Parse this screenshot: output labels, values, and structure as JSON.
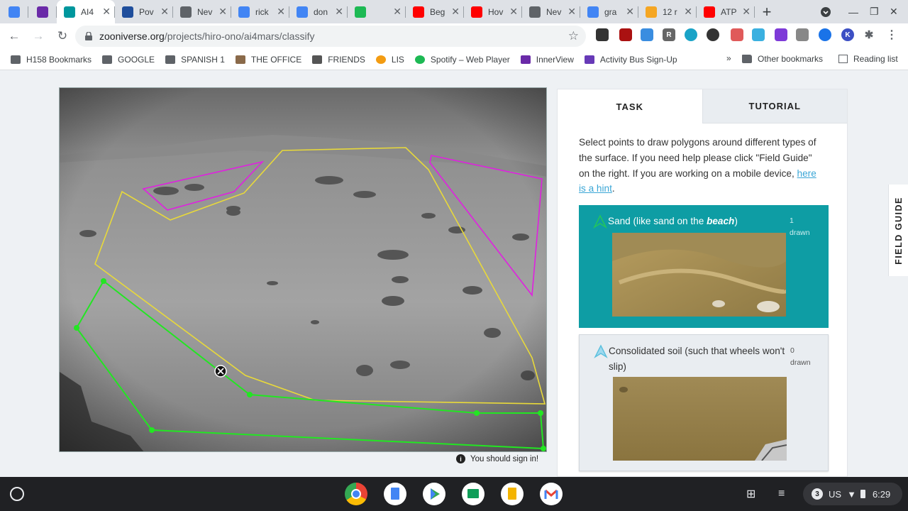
{
  "browser": {
    "tabs": [
      {
        "title": "",
        "favicon": "google-docs-icon",
        "color": "#4285f4"
      },
      {
        "title": "",
        "favicon": "innerview-icon",
        "color": "#6a2aa8"
      },
      {
        "title": "AI4",
        "favicon": "zooniverse-icon",
        "color": "#00979d",
        "active": true
      },
      {
        "title": "Pov",
        "favicon": "pearson-icon",
        "color": "#1f4e9c"
      },
      {
        "title": "Nev",
        "favicon": "chrome-icon",
        "color": "#5f6368"
      },
      {
        "title": "rick",
        "favicon": "google-icon",
        "color": "#4285f4"
      },
      {
        "title": "don",
        "favicon": "google-icon",
        "color": "#4285f4"
      },
      {
        "title": "",
        "favicon": "spotify-icon",
        "color": "#1db954"
      },
      {
        "title": "Beg",
        "favicon": "youtube-icon",
        "color": "#ff0000"
      },
      {
        "title": "Hov",
        "favicon": "youtube-icon",
        "color": "#ff0000"
      },
      {
        "title": "Nev",
        "favicon": "chrome-icon",
        "color": "#5f6368"
      },
      {
        "title": "gra",
        "favicon": "google-icon",
        "color": "#4285f4"
      },
      {
        "title": "12 r",
        "favicon": "nike-icon",
        "color": "#f5a623"
      },
      {
        "title": "ATP & R",
        "favicon": "youtube-icon",
        "color": "#ff0000"
      }
    ],
    "url_domain": "zooniverse.org",
    "url_path": "/projects/hiro-ono/ai4mars/classify"
  },
  "bookmarks": [
    {
      "label": "H158 Bookmarks",
      "icon": "bookmark-manager-icon"
    },
    {
      "label": "GOOGLE",
      "icon": "folder-icon"
    },
    {
      "label": "SPANISH 1",
      "icon": "folder-icon"
    },
    {
      "label": "THE OFFICE",
      "icon": "the-office-icon"
    },
    {
      "label": "FRIENDS",
      "icon": "friends-icon"
    },
    {
      "label": "LIS",
      "icon": "lis-icon"
    },
    {
      "label": "Spotify – Web Player",
      "icon": "spotify-icon"
    },
    {
      "label": "InnerView",
      "icon": "innerview-icon"
    },
    {
      "label": "Activity Bus Sign-Up",
      "icon": "forms-icon"
    }
  ],
  "bookmarks_overflow": "»",
  "other_bookmarks": "Other bookmarks",
  "reading_list": "Reading list",
  "signin_notice": "You should sign in!",
  "task_panel": {
    "tab_task": "TASK",
    "tab_tutorial": "TUTORIAL",
    "instructions": "Select points to draw polygons around different types of the surface. If you need help please click \"Field Guide\" on the right. If you are working on a mobile device, ",
    "hint_link": "here is a hint",
    "instructions_end": ".",
    "choices": [
      {
        "label_pre": "Sand (like sand on the ",
        "label_em": "beach",
        "label_post": ")",
        "count": "1",
        "count_label": "drawn",
        "color": "#22c55e",
        "selected": true
      },
      {
        "label": "Consolidated soil (such that wheels won't slip)",
        "count": "0",
        "count_label": "drawn",
        "color": "#5bc0de",
        "selected": false
      }
    ]
  },
  "field_guide": "FIELD GUIDE",
  "shelf": {
    "notification_count": "3",
    "locale": "US",
    "time": "6:29"
  },
  "annotation_colors": {
    "sand": "#22e622",
    "yellow": "#e8d93a",
    "magenta": "#e020e0"
  }
}
